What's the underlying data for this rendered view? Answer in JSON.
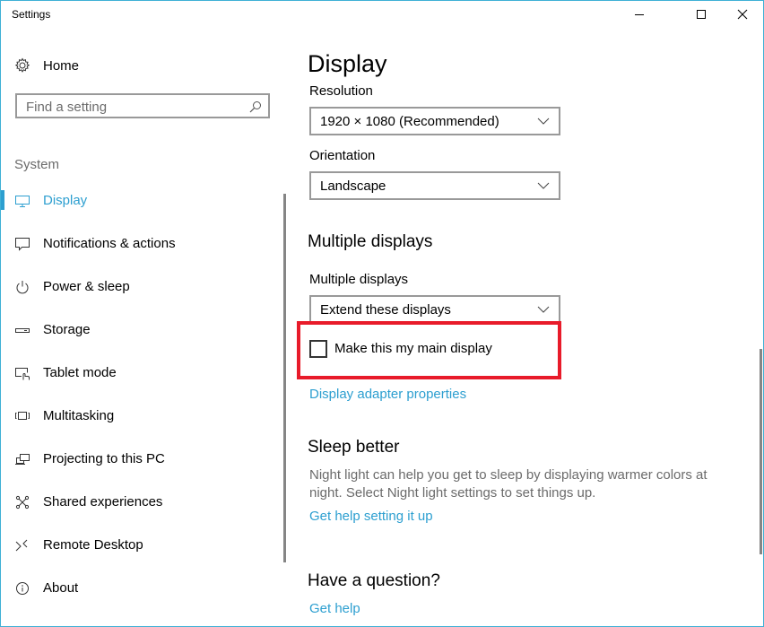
{
  "window": {
    "title": "Settings",
    "controls": {
      "minimize": "minimize-icon",
      "maximize": "maximize-icon",
      "close": "close-icon"
    }
  },
  "sidebar": {
    "home_label": "Home",
    "search_placeholder": "Find a setting",
    "section_label": "System",
    "items": [
      {
        "label": "Display",
        "icon": "monitor-icon",
        "active": true
      },
      {
        "label": "Notifications & actions",
        "icon": "message-icon",
        "active": false
      },
      {
        "label": "Power & sleep",
        "icon": "power-icon",
        "active": false
      },
      {
        "label": "Storage",
        "icon": "drive-icon",
        "active": false
      },
      {
        "label": "Tablet mode",
        "icon": "tablet-mode-icon",
        "active": false
      },
      {
        "label": "Multitasking",
        "icon": "multitasking-icon",
        "active": false
      },
      {
        "label": "Projecting to this PC",
        "icon": "projecting-icon",
        "active": false
      },
      {
        "label": "Shared experiences",
        "icon": "shared-experiences-icon",
        "active": false
      },
      {
        "label": "Remote Desktop",
        "icon": "remote-desktop-icon",
        "active": false
      },
      {
        "label": "About",
        "icon": "info-icon",
        "active": false
      }
    ]
  },
  "main": {
    "title": "Display",
    "resolution": {
      "label": "Resolution",
      "value": "1920 × 1080 (Recommended)"
    },
    "orientation": {
      "label": "Orientation",
      "value": "Landscape"
    },
    "multiple_displays": {
      "heading": "Multiple displays",
      "label": "Multiple displays",
      "value": "Extend these displays",
      "checkbox_label": "Make this my main display",
      "checkbox_checked": false,
      "adapter_link": "Display adapter properties"
    },
    "sleep_better": {
      "heading": "Sleep better",
      "text": "Night light can help you get to sleep by displaying warmer colors at night. Select Night light settings to set things up.",
      "link": "Get help setting it up"
    },
    "question": {
      "heading": "Have a question?",
      "link": "Get help"
    }
  },
  "colors": {
    "accent": "#2d9fd0",
    "highlight_box": "#e81b2a",
    "window_border": "#3fb0d6"
  }
}
